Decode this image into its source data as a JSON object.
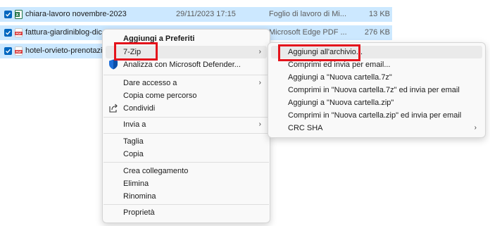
{
  "files": [
    {
      "name": "chiara-lavoro novembre-2023",
      "date": "29/11/2023 17:15",
      "type": "Foglio di lavoro di Mi...",
      "size": "13 KB",
      "icon": "excel-file-icon"
    },
    {
      "name": "fattura-giardiniblog-dicem",
      "date": "",
      "type": "Microsoft Edge PDF ...",
      "size": "276 KB",
      "icon": "pdf-file-icon"
    },
    {
      "name": "hotel-orvieto-prenotazion",
      "date": "",
      "type": "",
      "size": "",
      "icon": "pdf-file-icon"
    }
  ],
  "context_menu": {
    "items": [
      {
        "label": "Aggiungi a Preferiti"
      },
      {
        "label": "7-Zip"
      },
      {
        "label": "Analizza con Microsoft Defender..."
      },
      {
        "label": "Dare accesso a"
      },
      {
        "label": "Copia come percorso"
      },
      {
        "label": "Condividi"
      },
      {
        "label": "Invia a"
      },
      {
        "label": "Taglia"
      },
      {
        "label": "Copia"
      },
      {
        "label": "Crea collegamento"
      },
      {
        "label": "Elimina"
      },
      {
        "label": "Rinomina"
      },
      {
        "label": "Proprietà"
      }
    ]
  },
  "zip_submenu": {
    "items": [
      {
        "label": "Aggiungi all'archivio..."
      },
      {
        "label": "Comprimi ed invia per email..."
      },
      {
        "label": "Aggiungi a \"Nuova cartella.7z\""
      },
      {
        "label": "Comprimi in \"Nuova cartella.7z\" ed invia per email"
      },
      {
        "label": "Aggiungi a \"Nuova cartella.zip\""
      },
      {
        "label": "Comprimi in \"Nuova cartella.zip\" ed invia per email"
      },
      {
        "label": "CRC SHA"
      }
    ]
  },
  "colors": {
    "selection": "#cce8ff",
    "highlight_box": "#e4141c",
    "checkbox": "#0067c0"
  }
}
